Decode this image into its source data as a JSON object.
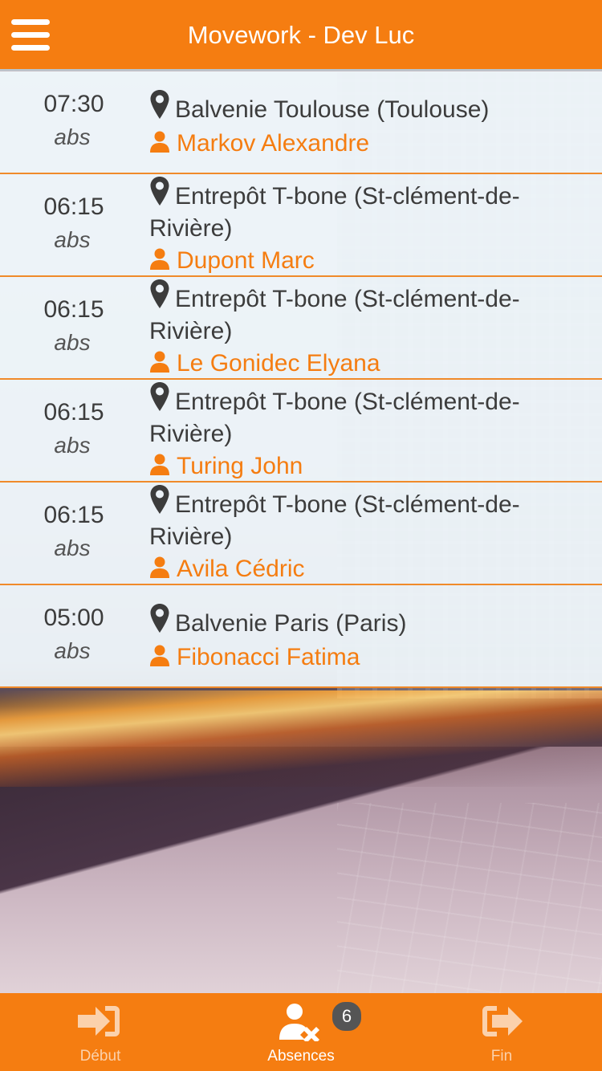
{
  "header": {
    "title": "Movework - Dev Luc",
    "menu_icon": "hamburger-menu-icon"
  },
  "absences": [
    {
      "time": "07:30",
      "type": "abs",
      "location_line1": "Balvenie Toulouse (Toulouse)",
      "location_line2": "",
      "person": "Markov Alexandre"
    },
    {
      "time": "06:15",
      "type": "abs",
      "location_line1": "Entrepôt T-bone (St-clément-de-",
      "location_line2": "Rivière)",
      "person": "Dupont Marc"
    },
    {
      "time": "06:15",
      "type": "abs",
      "location_line1": "Entrepôt T-bone (St-clément-de-",
      "location_line2": "Rivière)",
      "person": "Le Gonidec Elyana"
    },
    {
      "time": "06:15",
      "type": "abs",
      "location_line1": "Entrepôt T-bone (St-clément-de-",
      "location_line2": "Rivière)",
      "person": "Turing John"
    },
    {
      "time": "06:15",
      "type": "abs",
      "location_line1": "Entrepôt T-bone (St-clément-de-",
      "location_line2": "Rivière)",
      "person": "Avila Cédric"
    },
    {
      "time": "05:00",
      "type": "abs",
      "location_line1": "Balvenie Paris (Paris)",
      "location_line2": "",
      "person": "Fibonacci Fatima"
    }
  ],
  "tabbar": {
    "tabs": [
      {
        "label": "Début",
        "icon": "sign-in-icon",
        "active": false
      },
      {
        "label": "Absences",
        "icon": "user-remove-icon",
        "active": true
      },
      {
        "label": "Fin",
        "icon": "sign-out-icon",
        "active": false
      }
    ],
    "absences_badge": "6"
  },
  "colors": {
    "accent": "#f57d11",
    "text": "#3c3c3c",
    "badge": "#555555"
  }
}
